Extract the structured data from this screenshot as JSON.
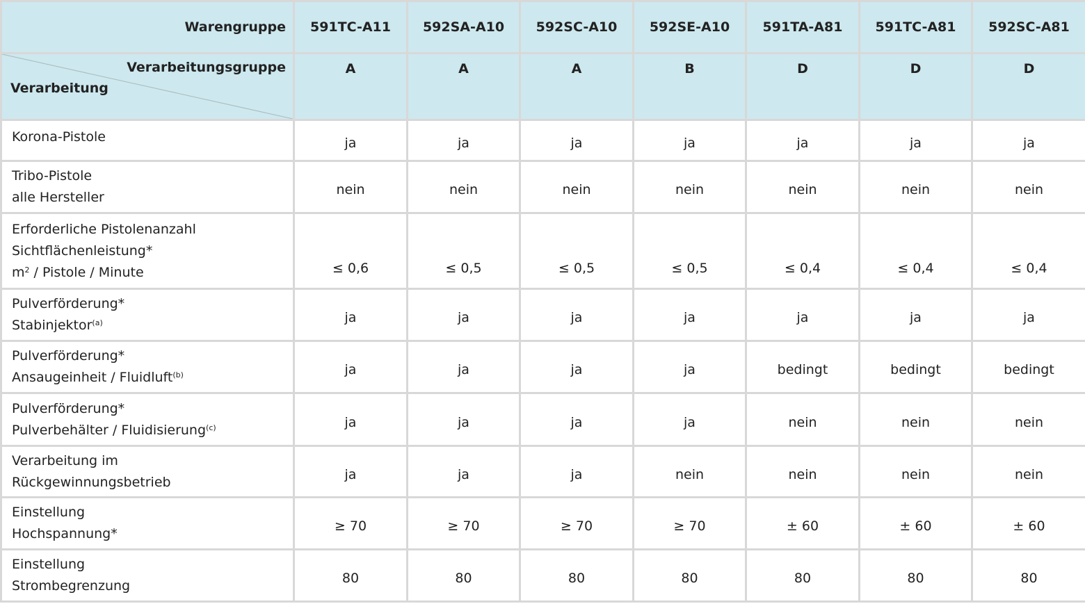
{
  "header": {
    "warengruppe_label": "Warengruppe",
    "verarbeitungsgruppe_label": "Verarbeitungsgruppe",
    "verarbeitung_label": "Verarbeitung",
    "columns": [
      {
        "code": "591TC-A11",
        "group": "A"
      },
      {
        "code": "592SA-A10",
        "group": "A"
      },
      {
        "code": "592SC-A10",
        "group": "A"
      },
      {
        "code": "592SE-A10",
        "group": "B"
      },
      {
        "code": "591TA-A81",
        "group": "D"
      },
      {
        "code": "591TC-A81",
        "group": "D"
      },
      {
        "code": "592SC-A81",
        "group": "D"
      }
    ]
  },
  "colors": {
    "header_bg": "#cde8ee",
    "border": "#d8d8d8",
    "text": "#222222"
  },
  "rows": [
    {
      "label": [
        {
          "text": "Korona-Pistole"
        }
      ],
      "values": [
        "ja",
        "ja",
        "ja",
        "ja",
        "ja",
        "ja",
        "ja"
      ]
    },
    {
      "label": [
        {
          "text": "Tribo-Pistole"
        },
        {
          "text": "alle Hersteller"
        }
      ],
      "values": [
        "nein",
        "nein",
        "nein",
        "nein",
        "nein",
        "nein",
        "nein"
      ]
    },
    {
      "label": [
        {
          "text": "Erforderliche Pistolenanzahl"
        },
        {
          "text": "Sichtflächenleistung*"
        },
        {
          "text": "m",
          "sup": "2",
          "after": " / Pistole / Minute"
        }
      ],
      "values": [
        "≤ 0,6",
        "≤ 0,5",
        "≤ 0,5",
        "≤ 0,5",
        "≤ 0,4",
        "≤ 0,4",
        "≤ 0,4"
      ]
    },
    {
      "label": [
        {
          "text": "Pulverförderung*"
        },
        {
          "text": "Stabinjektor",
          "sup": "(a)"
        }
      ],
      "values": [
        "ja",
        "ja",
        "ja",
        "ja",
        "ja",
        "ja",
        "ja"
      ]
    },
    {
      "label": [
        {
          "text": "Pulverförderung*"
        },
        {
          "text": "Ansaugeinheit / Fluidluft",
          "sup": "(b)"
        }
      ],
      "values": [
        "ja",
        "ja",
        "ja",
        "ja",
        "bedingt",
        "bedingt",
        "bedingt"
      ]
    },
    {
      "label": [
        {
          "text": "Pulverförderung*"
        },
        {
          "text": "Pulverbehälter / Fluidisierung",
          "sup": "(c)"
        }
      ],
      "values": [
        "ja",
        "ja",
        "ja",
        "ja",
        "nein",
        "nein",
        "nein"
      ]
    },
    {
      "label": [
        {
          "text": "Verarbeitung im"
        },
        {
          "text": "Rückgewinnungsbetrieb"
        }
      ],
      "values": [
        "ja",
        "ja",
        "ja",
        "nein",
        "nein",
        "nein",
        "nein"
      ]
    },
    {
      "label": [
        {
          "text": "Einstellung"
        },
        {
          "text": "Hochspannung*"
        }
      ],
      "values": [
        "≥ 70",
        "≥ 70",
        "≥ 70",
        "≥ 70",
        "± 60",
        "± 60",
        "± 60"
      ]
    },
    {
      "label": [
        {
          "text": "Einstellung"
        },
        {
          "text": "Strombegrenzung"
        }
      ],
      "values": [
        "80",
        "80",
        "80",
        "80",
        "80",
        "80",
        "80"
      ]
    }
  ]
}
